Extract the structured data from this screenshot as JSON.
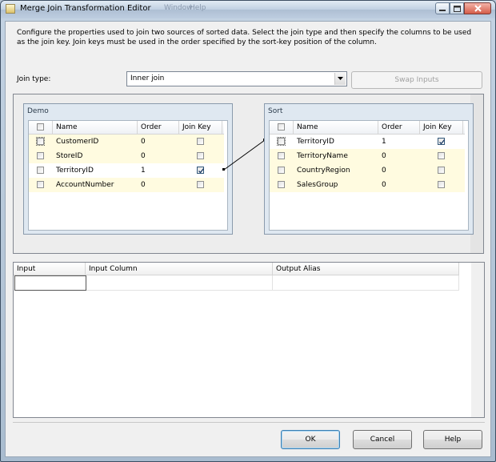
{
  "window": {
    "title": "Merge Join Transformation Editor",
    "ghost_menu": [
      "Window",
      "Help"
    ]
  },
  "description": "Configure the properties used to join two sources of sorted data. Select the join type and then specify the columns to be used as the join key. Join keys must be used in the order specified by the sort-key position of the column.",
  "join_type": {
    "label": "Join type:",
    "selected": "Inner join"
  },
  "swap_inputs_label": "Swap Inputs",
  "demo": {
    "title": "Demo",
    "headers": [
      "Name",
      "Order",
      "Join Key"
    ],
    "rows": [
      {
        "name": "CustomerID",
        "order": "0",
        "join_key": false
      },
      {
        "name": "StoreID",
        "order": "0",
        "join_key": false
      },
      {
        "name": "TerritoryID",
        "order": "1",
        "join_key": true
      },
      {
        "name": "AccountNumber",
        "order": "0",
        "join_key": false
      }
    ]
  },
  "sort": {
    "title": "Sort",
    "headers": [
      "Name",
      "Order",
      "Join Key"
    ],
    "rows": [
      {
        "name": "TerritoryID",
        "order": "1",
        "join_key": true
      },
      {
        "name": "TerritoryName",
        "order": "0",
        "join_key": false
      },
      {
        "name": "CountryRegion",
        "order": "0",
        "join_key": false
      },
      {
        "name": "SalesGroup",
        "order": "0",
        "join_key": false
      }
    ]
  },
  "mapping": {
    "headers": [
      "Input",
      "Input Column",
      "Output Alias"
    ]
  },
  "buttons": {
    "ok": "OK",
    "cancel": "Cancel",
    "help": "Help"
  },
  "colors": {
    "alt_row": "#fffbe0",
    "table_frame": "#dfe8f1"
  }
}
